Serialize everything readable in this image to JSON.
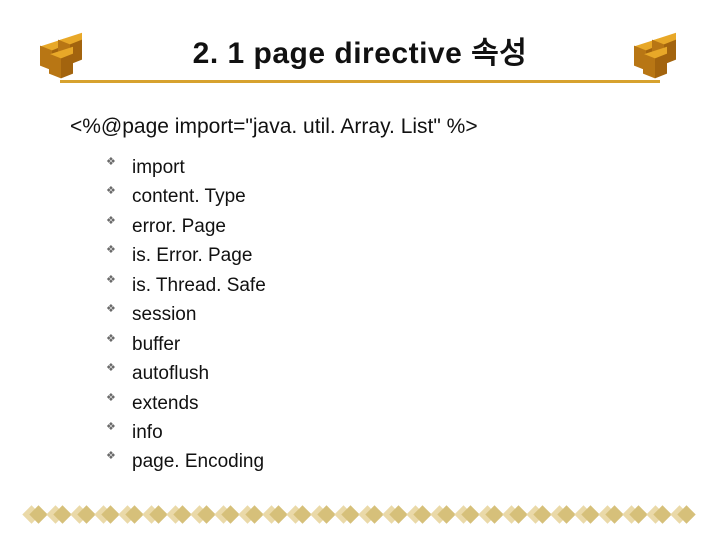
{
  "header": {
    "title": "2. 1 page directive 속성"
  },
  "body": {
    "code_line": "<%@page import=\"java. util. Array. List\" %>",
    "attributes": [
      "import",
      "content. Type",
      "error. Page",
      "is. Error. Page",
      "is. Thread. Safe",
      "session",
      "buffer",
      "autoflush",
      "extends",
      "info",
      "page. Encoding"
    ]
  },
  "footer": {
    "diamond_count": 28
  }
}
